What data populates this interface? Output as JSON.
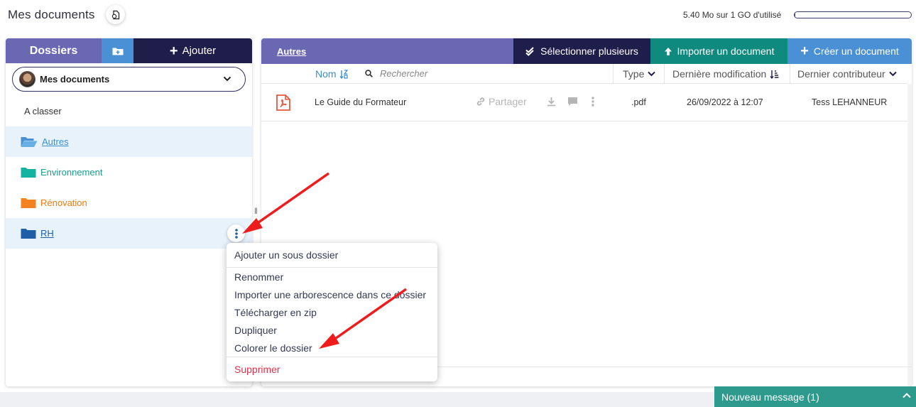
{
  "header": {
    "title": "Mes documents",
    "storage_text": "5.40 Mo sur 1 GO d'utilisé",
    "storage_used_fraction": 0.0054
  },
  "left_panel": {
    "tab_label": "Dossiers",
    "add_label": "Ajouter",
    "space_selector": {
      "label": "Mes documents"
    },
    "folders": [
      {
        "label": "A classer"
      },
      {
        "label": "Autres",
        "color": "#4a90d4"
      },
      {
        "label": "Environnement",
        "color": "#14b2a0"
      },
      {
        "label": "Rénovation",
        "color": "#f58220"
      },
      {
        "label": "RH",
        "color": "#1f5fa8"
      }
    ]
  },
  "right_panel": {
    "breadcrumb": "Autres",
    "select_multiple_label": "Sélectionner plusieurs",
    "import_label": "Importer un document",
    "create_label": "Créer un document",
    "columns": {
      "name": "Nom",
      "search_placeholder": "Rechercher",
      "type": "Type",
      "last_modified": "Dernière modification",
      "last_contributor": "Dernier contributeur"
    },
    "files": [
      {
        "name": "Le Guide du Formateur",
        "share_label": "Partager",
        "type": ".pdf",
        "modified": "26/09/2022 à 12:07",
        "contributor": "Tess LEHANNEUR"
      }
    ]
  },
  "context_menu": {
    "items": [
      "Ajouter un sous dossier",
      "Renommer",
      "Importer une arborescence dans ce dossier",
      "Télécharger en zip",
      "Dupliquer",
      "Colorer le dossier"
    ],
    "danger_item": "Supprimer",
    "danger_color": "#e2304a"
  },
  "chat": {
    "label": "Nouveau message (1)"
  },
  "colors": {
    "purple": "#6a68b3",
    "navy": "#1f1d4a",
    "teal": "#0f8a7e",
    "blue": "#4a90d4",
    "annotation_red": "#ee1c1c"
  }
}
